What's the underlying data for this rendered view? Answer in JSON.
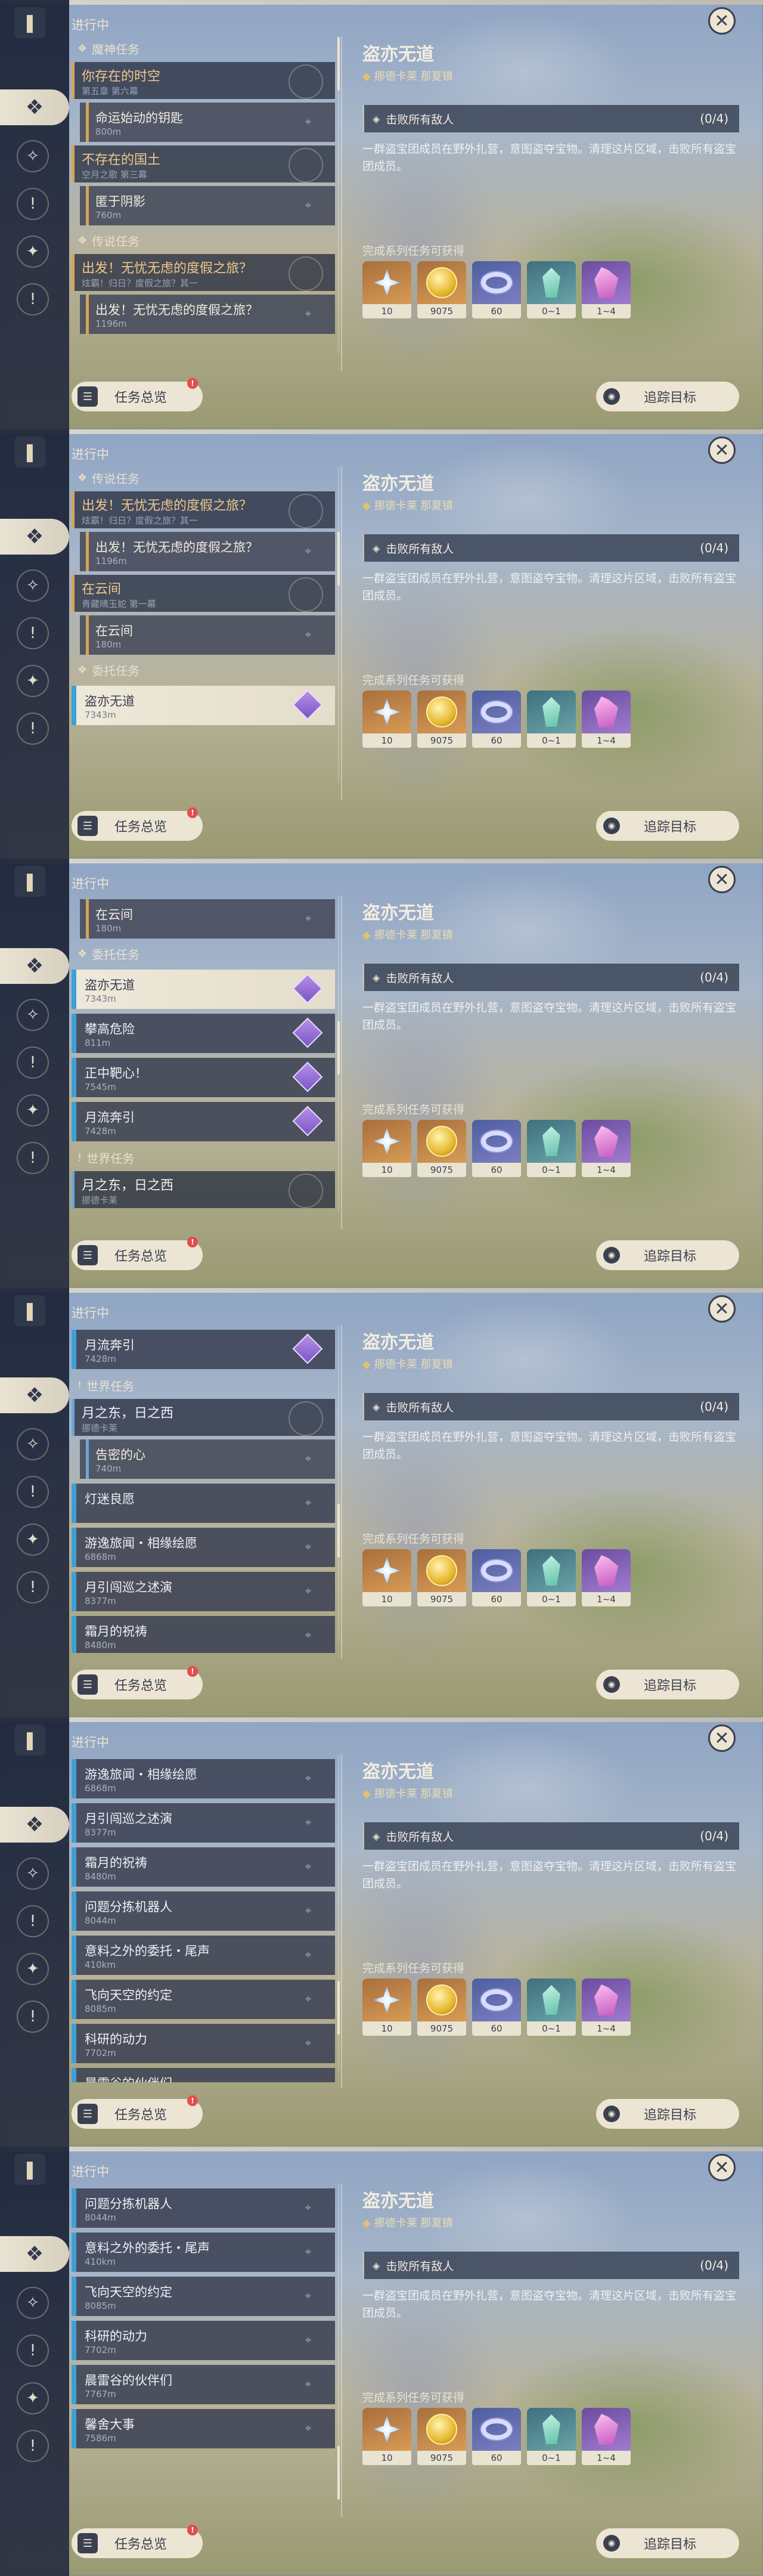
{
  "header_label": "进行中",
  "sidebar": [
    {
      "name": "sidebar-all-quests",
      "icon": "diamond-grid-icon"
    },
    {
      "name": "sidebar-archon-quests",
      "icon": "crystal-icon"
    },
    {
      "name": "sidebar-story-quests",
      "icon": "exclamation-icon"
    },
    {
      "name": "sidebar-world-quests",
      "icon": "star-emblem-icon"
    },
    {
      "name": "sidebar-commissions",
      "icon": "exclamation-circle-icon"
    }
  ],
  "buttons": {
    "overview": "任务总览",
    "track": "追踪目标"
  },
  "detail": {
    "title": "盗亦无道",
    "location": "挪德卡莱 那夏镇",
    "objective": "击败所有敌人",
    "progress": "(0/4)",
    "description": "一群盗宝团成员在野外扎营，意图盗夺宝物。清理这片区域，击败所有盗宝团成员。",
    "rewards_label": "完成系列任务可获得",
    "rewards": [
      {
        "name": "reward-adventure-exp",
        "qty": "10",
        "style": "r-orange",
        "shape": "shape-star",
        "icon": "adventure-exp-icon"
      },
      {
        "name": "reward-mora",
        "qty": "9075",
        "style": "r-orange",
        "shape": "shape-coin",
        "icon": "mora-coin-icon"
      },
      {
        "name": "reward-friendship",
        "qty": "60",
        "style": "r-purple",
        "shape": "shape-ring",
        "icon": "friendship-ring-icon"
      },
      {
        "name": "reward-ore-a",
        "qty": "0~1",
        "style": "r-teal",
        "shape": "shape-crystal",
        "icon": "crystal-ore-icon"
      },
      {
        "name": "reward-ore-b",
        "qty": "1~4",
        "style": "r-violet",
        "shape": "shape-crystal2",
        "icon": "crystal-cluster-icon"
      }
    ]
  },
  "sections": {
    "archon": "魔神任务",
    "story": "传说任务",
    "commission": "委托任务",
    "world": "世界任务"
  },
  "quests": {
    "q1": {
      "title": "你存在的时空",
      "sub": "第五章 第六幕"
    },
    "q1a": {
      "title": "命运始动的钥匙",
      "sub": "800m"
    },
    "q2": {
      "title": "不存在的国土",
      "sub": "空月之歌 第三幕"
    },
    "q2a": {
      "title": "匿于阴影",
      "sub": "760m"
    },
    "q3": {
      "title": "出发！无忧无虑的度假之旅？",
      "sub": "炫霸！归日？度假之旅？其一"
    },
    "q3a": {
      "title": "出发！无忧无虑的度假之旅？",
      "sub": "1196m"
    },
    "q4": {
      "title": "在云间",
      "sub": "青藏晴玉蛇 第一幕"
    },
    "q4a": {
      "title": "在云间",
      "sub": "180m"
    },
    "c1": {
      "title": "盗亦无道",
      "sub": "7343m"
    },
    "c2": {
      "title": "攀高危险",
      "sub": "811m"
    },
    "c3": {
      "title": "正中靶心！",
      "sub": "7545m"
    },
    "c4": {
      "title": "月流奔引",
      "sub": "7428m"
    },
    "w1": {
      "title": "月之东，日之西",
      "sub": "挪德卡莱"
    },
    "w1a": {
      "title": "告密的心",
      "sub": "740m"
    },
    "w2": {
      "title": "灯迷良愿",
      "sub": ""
    },
    "w3": {
      "title": "游逸旅闻・相缘绘愿",
      "sub": "6868m"
    },
    "w4": {
      "title": "月引闯巡之述演",
      "sub": "8377m"
    },
    "w5": {
      "title": "霜月的祝祷",
      "sub": "8480m"
    },
    "w6": {
      "title": "问题分拣机器人",
      "sub": "8044m"
    },
    "w7": {
      "title": "意料之外的委托・尾声",
      "sub": "410km"
    },
    "w8": {
      "title": "飞向天空的约定",
      "sub": "8085m"
    },
    "w9": {
      "title": "科研的动力",
      "sub": "7702m"
    },
    "w10": {
      "title": "晨雷谷的伙伴们",
      "sub": "7767m"
    },
    "w11": {
      "title": "晨雷谷的伙伴们",
      "sub": "7767m"
    },
    "w12": {
      "title": "馨舍大事",
      "sub": "7586m"
    }
  }
}
